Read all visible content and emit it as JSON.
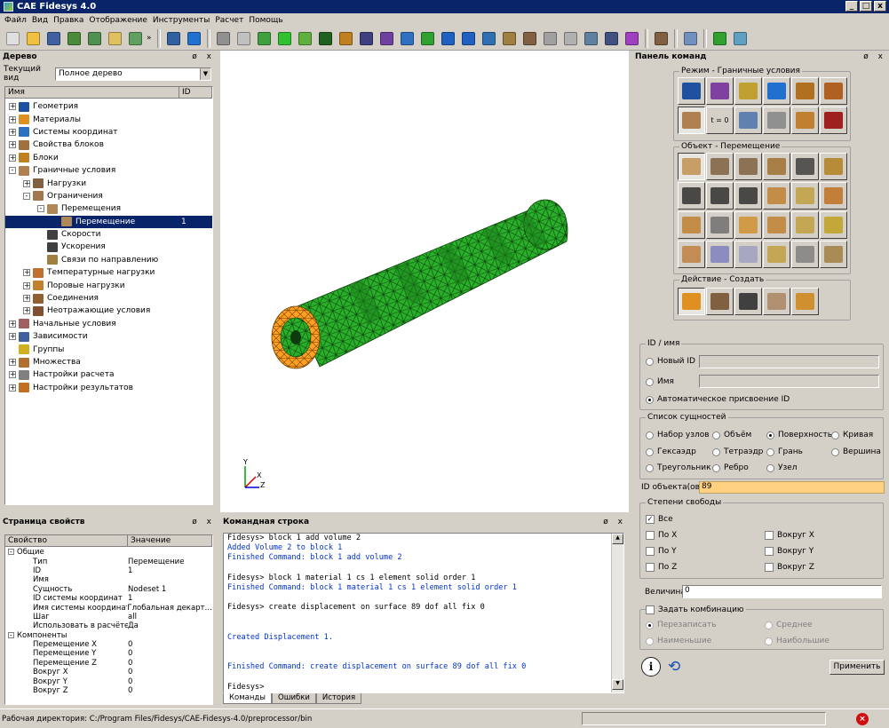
{
  "window": {
    "title": "CAE Fidesys 4.0",
    "min": "_",
    "max": "□",
    "close": "x"
  },
  "menu": [
    "Файл",
    "Вид",
    "Правка",
    "Отображение",
    "Инструменты",
    "Расчет",
    "Помощь"
  ],
  "toolbar_more": "»",
  "tree_panel": {
    "title": "Дерево",
    "controls": "ø x",
    "view_label": "Текущий вид",
    "view_value": "Полное дерево",
    "col_name": "Имя",
    "col_id": "ID",
    "items": [
      {
        "label": "Геометрия",
        "indent": 0,
        "exp": "+",
        "icon": "#2050a0",
        "id": ""
      },
      {
        "label": "Материалы",
        "indent": 0,
        "exp": "+",
        "icon": "#e09020",
        "id": ""
      },
      {
        "label": "Системы координат",
        "indent": 0,
        "exp": "+",
        "icon": "#3070c0",
        "id": ""
      },
      {
        "label": "Свойства блоков",
        "indent": 0,
        "exp": "+",
        "icon": "#a07040",
        "id": ""
      },
      {
        "label": "Блоки",
        "indent": 0,
        "exp": "+",
        "icon": "#c08020",
        "id": ""
      },
      {
        "label": "Граничные условия",
        "indent": 0,
        "exp": "-",
        "icon": "#b08050",
        "id": ""
      },
      {
        "label": "Нагрузки",
        "indent": 1,
        "exp": "+",
        "icon": "#806040",
        "id": ""
      },
      {
        "label": "Ограничения",
        "indent": 1,
        "exp": "-",
        "icon": "#a07850",
        "id": ""
      },
      {
        "label": "Перемещения",
        "indent": 2,
        "exp": "-",
        "icon": "#b08858",
        "id": ""
      },
      {
        "label": "Перемещение",
        "indent": 3,
        "exp": "",
        "icon": "#b08858",
        "id": "1",
        "selected": true
      },
      {
        "label": "Скорости",
        "indent": 2,
        "exp": "",
        "icon": "#404040",
        "id": ""
      },
      {
        "label": "Ускорения",
        "indent": 2,
        "exp": "",
        "icon": "#404040",
        "id": ""
      },
      {
        "label": "Связи по направлению",
        "indent": 2,
        "exp": "",
        "icon": "#a08040",
        "id": ""
      },
      {
        "label": "Температурные нагрузки",
        "indent": 1,
        "exp": "+",
        "icon": "#c07030",
        "id": ""
      },
      {
        "label": "Поровые нагрузки",
        "indent": 1,
        "exp": "+",
        "icon": "#c08030",
        "id": ""
      },
      {
        "label": "Соединения",
        "indent": 1,
        "exp": "+",
        "icon": "#906030",
        "id": ""
      },
      {
        "label": "Неотражающие условия",
        "indent": 1,
        "exp": "+",
        "icon": "#805030",
        "id": ""
      },
      {
        "label": "Начальные условия",
        "indent": 0,
        "exp": "+",
        "icon": "#a06060",
        "id": ""
      },
      {
        "label": "Зависимости",
        "indent": 0,
        "exp": "+",
        "icon": "#4060a0",
        "id": ""
      },
      {
        "label": "Группы",
        "indent": 0,
        "exp": "",
        "icon": "#d0b020",
        "id": ""
      },
      {
        "label": "Множества",
        "indent": 0,
        "exp": "+",
        "icon": "#b07030",
        "id": ""
      },
      {
        "label": "Настройки расчета",
        "indent": 0,
        "exp": "+",
        "icon": "#808080",
        "id": ""
      },
      {
        "label": "Настройки результатов",
        "indent": 0,
        "exp": "+",
        "icon": "#c07020",
        "id": ""
      }
    ]
  },
  "props_panel": {
    "title": "Страница свойств",
    "controls": "ø x",
    "col_prop": "Свойство",
    "col_val": "Значение",
    "rows": [
      {
        "k": "Общие",
        "v": "",
        "indent": 0,
        "exp": "-"
      },
      {
        "k": "Тип",
        "v": "Перемещение",
        "indent": 1,
        "exp": ""
      },
      {
        "k": "ID",
        "v": "1",
        "indent": 1,
        "exp": ""
      },
      {
        "k": "Имя",
        "v": "",
        "indent": 1,
        "exp": ""
      },
      {
        "k": "Сущность",
        "v": "Nodeset 1",
        "indent": 1,
        "exp": ""
      },
      {
        "k": "ID системы координат",
        "v": "1",
        "indent": 1,
        "exp": ""
      },
      {
        "k": "Имя системы координат",
        "v": "Глобальная декарт…",
        "indent": 1,
        "exp": ""
      },
      {
        "k": "Шаг",
        "v": "all",
        "indent": 1,
        "exp": ""
      },
      {
        "k": "Использовать в расчёте",
        "v": "Да",
        "indent": 1,
        "exp": ""
      },
      {
        "k": "Компоненты",
        "v": "",
        "indent": 0,
        "exp": "-"
      },
      {
        "k": "Перемещение X",
        "v": "0",
        "indent": 1,
        "exp": ""
      },
      {
        "k": "Перемещение Y",
        "v": "0",
        "indent": 1,
        "exp": ""
      },
      {
        "k": "Перемещение Z",
        "v": "0",
        "indent": 1,
        "exp": ""
      },
      {
        "k": "Вокруг X",
        "v": "0",
        "indent": 1,
        "exp": ""
      },
      {
        "k": "Вокруг Y",
        "v": "0",
        "indent": 1,
        "exp": ""
      },
      {
        "k": "Вокруг Z",
        "v": "0",
        "indent": 1,
        "exp": ""
      }
    ]
  },
  "viewport": {
    "axes": {
      "x": "X",
      "y": "Y",
      "z": "Z"
    }
  },
  "console": {
    "title": "Командная строка",
    "controls": "ø x",
    "lines": [
      {
        "t": "Fidesys> block 1 add volume 2",
        "c": "k"
      },
      {
        "t": "Added Volume 2 to block 1",
        "c": "b"
      },
      {
        "t": "Finished Command: block 1 add volume 2",
        "c": "b"
      },
      {
        "t": "",
        "c": "k"
      },
      {
        "t": "Fidesys> block 1 material 1 cs 1 element solid order 1",
        "c": "k"
      },
      {
        "t": "Finished Command: block 1 material 1 cs 1 element solid order 1",
        "c": "b"
      },
      {
        "t": "",
        "c": "k"
      },
      {
        "t": "Fidesys> create displacement on surface 89 dof all fix 0",
        "c": "k"
      },
      {
        "t": "",
        "c": "k"
      },
      {
        "t": "",
        "c": "k"
      },
      {
        "t": "Created Displacement 1.",
        "c": "b"
      },
      {
        "t": "",
        "c": "k"
      },
      {
        "t": "",
        "c": "k"
      },
      {
        "t": "Finished Command: create displacement on surface 89 dof all fix 0",
        "c": "b"
      },
      {
        "t": "",
        "c": "k"
      },
      {
        "t": "Fidesys>",
        "c": "k"
      }
    ],
    "tabs": [
      "Команды",
      "Ошибки",
      "История"
    ]
  },
  "cmd_panel": {
    "title": "Панель команд",
    "controls": "ø x",
    "mode_label": "Режим - Граничные условия",
    "object_label": "Объект - Перемещение",
    "action_label": "Действие - Создать",
    "t0_label": "t = 0",
    "mode_icons": [
      "mesh-icon",
      "cube-grid-icon",
      "material-icon",
      "axes-icon",
      "block-icon",
      "grid-icon",
      "bc-icon",
      "initial-icon",
      "chart-icon",
      "calc-icon",
      "results-icon",
      "probe-icon"
    ],
    "object_icons": [
      "displacement-icon",
      "force-icon",
      "pressure-icon",
      "distributed-icon",
      "gravity-icon",
      "rotate-icon",
      "velocity-icon",
      "angular-velocity-icon",
      "acceleration-icon",
      "contact-icon",
      "spring-icon",
      "constraint-icon",
      "temperature-icon",
      "heat-flux-icon",
      "convection-icon",
      "radiation-icon",
      "heat-source-icon",
      "sun-icon",
      "box-heat-icon",
      "direction-icon",
      "star-icon",
      "sun2-icon",
      "link-icon",
      "check-icon"
    ],
    "action_icons": [
      "create-icon",
      "edit-icon",
      "list-icon",
      "modify-icon",
      "delete-icon"
    ],
    "id_group": {
      "label": "ID / имя",
      "new_id": "Новый ID",
      "name": "Имя",
      "auto": "Автоматическое присвоение ID"
    },
    "entities": {
      "label": "Список сущностей",
      "options": [
        "Набор узлов",
        "Объём",
        "Поверхность",
        "Кривая",
        "Гексаэдр",
        "Тетраэдр",
        "Грань",
        "Вершина",
        "Треугольник",
        "Ребро",
        "Узел"
      ],
      "selected": "Поверхность"
    },
    "object_id_label": "ID объекта(ов)",
    "object_id_value": "89",
    "dof": {
      "label": "Степени свободы",
      "all": "Все",
      "options": [
        "По X",
        "Вокруг X",
        "По Y",
        "Вокруг Y",
        "По Z",
        "Вокруг Z"
      ]
    },
    "magnitude_label": "Величина",
    "magnitude_value": "0",
    "combo": {
      "label": "Задать комбинацию",
      "options": [
        "Перезаписать",
        "Среднее",
        "Наименьшие",
        "Наибольшие"
      ]
    },
    "apply": "Применить",
    "info_icon": "i"
  },
  "status": {
    "path": "Рабочая директория: C:/Program Files/Fidesys/CAE-Fidesys-4.0/preprocessor/bin"
  },
  "colors": {
    "accent": "#0a246a",
    "mesh_green": "#22aa22",
    "highlight_orange": "#ffa020",
    "id_field": "#ffd080"
  }
}
